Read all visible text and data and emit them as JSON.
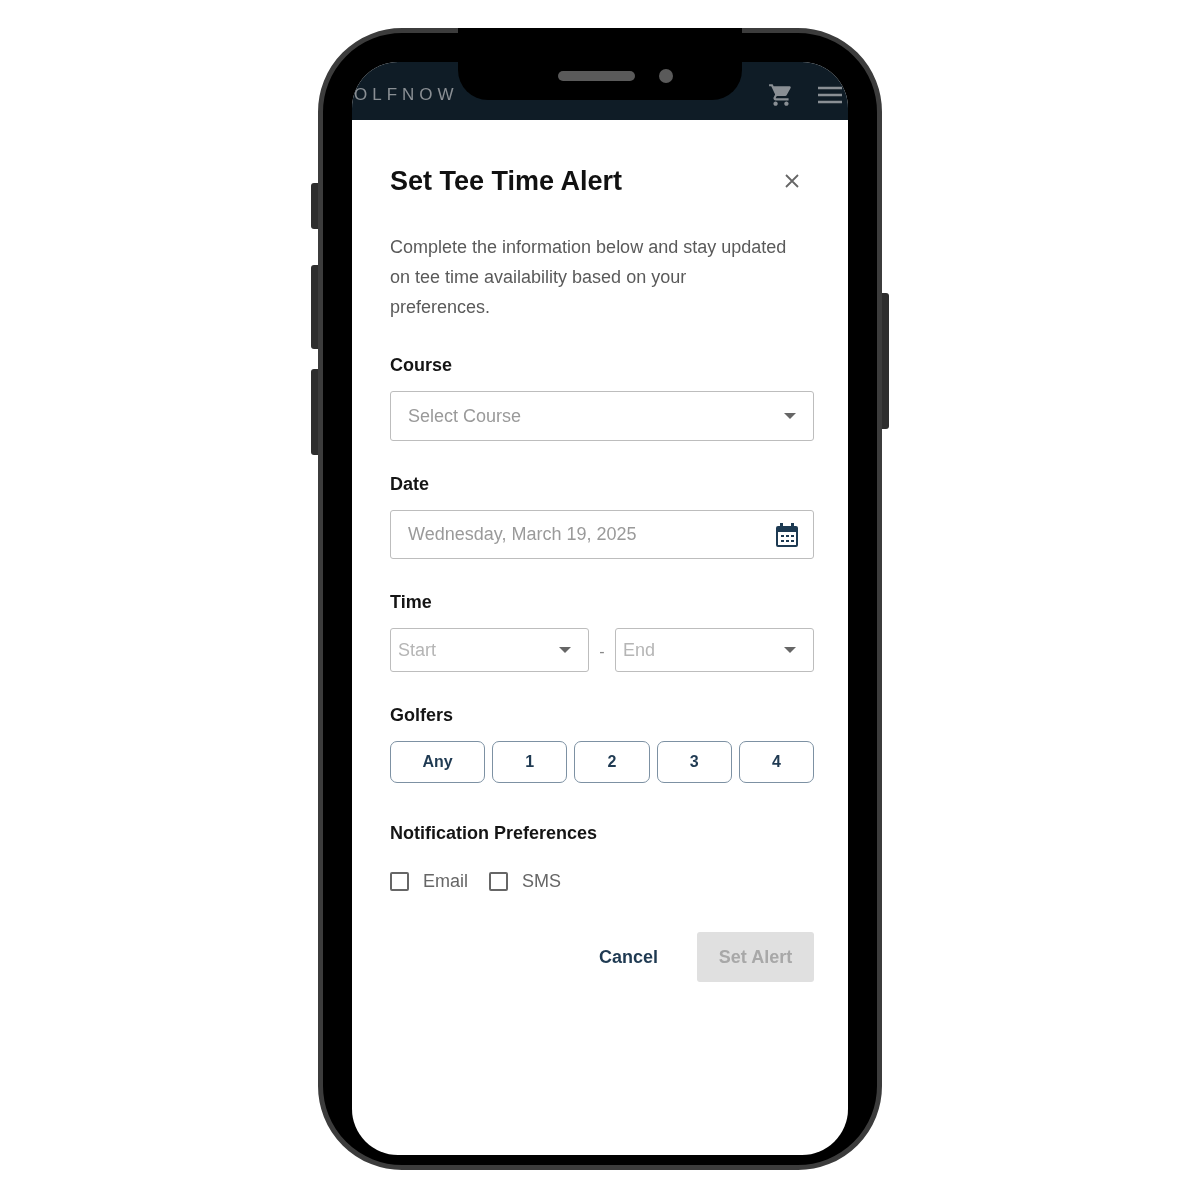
{
  "header": {
    "logo": "OLFNOW"
  },
  "dialog": {
    "title": "Set Tee Time Alert",
    "description": "Complete the information below and stay updated on tee time availability based on your preferences.",
    "course": {
      "label": "Course",
      "placeholder": "Select Course"
    },
    "date": {
      "label": "Date",
      "value": "Wednesday, March 19, 2025"
    },
    "time": {
      "label": "Time",
      "start_placeholder": "Start",
      "separator": "-",
      "end_placeholder": "End"
    },
    "golfers": {
      "label": "Golfers",
      "options": [
        {
          "label": "Any",
          "selected": false
        },
        {
          "label": "1",
          "selected": false
        },
        {
          "label": "2",
          "selected": false
        },
        {
          "label": "3",
          "selected": false
        },
        {
          "label": "4",
          "selected": false
        }
      ]
    },
    "notifications": {
      "label": "Notification Preferences",
      "options": [
        {
          "label": "Email",
          "checked": false
        },
        {
          "label": "SMS",
          "checked": false
        }
      ]
    },
    "actions": {
      "cancel": "Cancel",
      "submit": {
        "label": "Set Alert",
        "disabled": true
      }
    }
  }
}
